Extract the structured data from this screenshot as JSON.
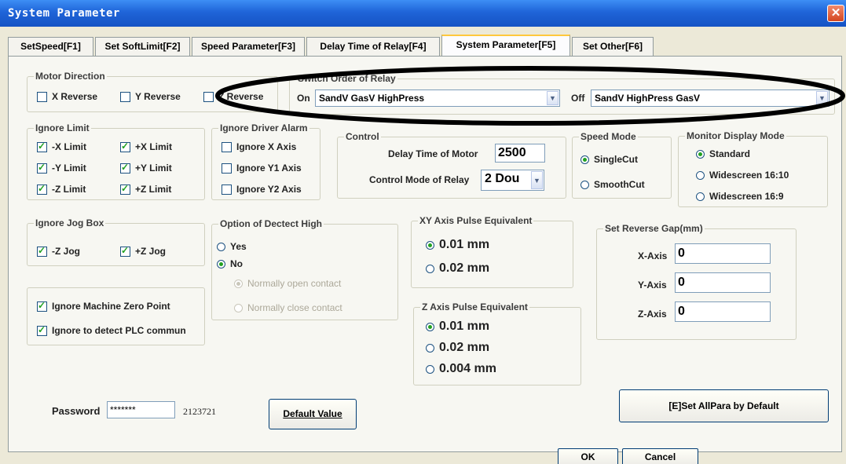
{
  "window": {
    "title": "System Parameter",
    "close_glyph": "✕"
  },
  "tabs": [
    {
      "label": "SetSpeed[F1]"
    },
    {
      "label": "Set SoftLimit[F2]"
    },
    {
      "label": "Speed Parameter[F3]"
    },
    {
      "label": "Delay Time of Relay[F4]"
    },
    {
      "label": "System Parameter[F5]",
      "active": true
    },
    {
      "label": "Set Other[F6]"
    }
  ],
  "motor_direction": {
    "title": "Motor Direction",
    "x_reverse": {
      "label": "X Reverse",
      "checked": false
    },
    "y_reverse": {
      "label": "Y Reverse",
      "checked": false
    },
    "z_reverse": {
      "label": "Z Reverse",
      "checked": false
    }
  },
  "switch_order": {
    "title": "Switch Order of Relay",
    "on_label": "On",
    "on_value": "SandV GasV HighPress",
    "off_label": "Off",
    "off_value": "SandV HighPress GasV"
  },
  "ignore_limit": {
    "title": "Ignore Limit",
    "items": [
      {
        "label": "-X Limit",
        "checked": true
      },
      {
        "label": "+X Limit",
        "checked": true
      },
      {
        "label": "-Y Limit",
        "checked": true
      },
      {
        "label": "+Y Limit",
        "checked": true
      },
      {
        "label": "-Z Limit",
        "checked": true
      },
      {
        "label": "+Z Limit",
        "checked": true
      }
    ]
  },
  "ignore_driver_alarm": {
    "title": "Ignore Driver Alarm",
    "items": [
      {
        "label": "Ignore X Axis",
        "checked": false
      },
      {
        "label": "Ignore Y1 Axis",
        "checked": false
      },
      {
        "label": "Ignore Y2 Axis",
        "checked": false
      }
    ]
  },
  "control": {
    "title": "Control",
    "delay_label": "Delay Time of Motor",
    "delay_value": "2500",
    "mode_label": "Control Mode of Relay",
    "mode_value": "2 Dou"
  },
  "speed_mode": {
    "title": "Speed Mode",
    "options": [
      {
        "label": "SingleCut",
        "selected": true
      },
      {
        "label": "SmoothCut",
        "selected": false
      }
    ]
  },
  "monitor_mode": {
    "title": "Monitor Display Mode",
    "options": [
      {
        "label": "Standard",
        "selected": true
      },
      {
        "label": "Widescreen 16:10",
        "selected": false
      },
      {
        "label": "Widescreen 16:9",
        "selected": false
      }
    ]
  },
  "ignore_jog": {
    "title": "Ignore Jog Box",
    "items": [
      {
        "label": "-Z Jog",
        "checked": true
      },
      {
        "label": "+Z Jog",
        "checked": true
      }
    ]
  },
  "option_high": {
    "title": "Option of Dectect High",
    "yes": "Yes",
    "no": "No",
    "selected": "No",
    "normally_open": "Normally open contact",
    "normally_close": "Normally close contact",
    "contact_selected": "open"
  },
  "xy_pulse": {
    "title": "XY Axis Pulse Equivalent",
    "options": [
      {
        "label": "0.01 mm",
        "selected": true
      },
      {
        "label": "0.02 mm",
        "selected": false
      }
    ]
  },
  "z_pulse": {
    "title": "Z Axis Pulse Equivalent",
    "options": [
      {
        "label": "0.01 mm",
        "selected": true
      },
      {
        "label": "0.02 mm",
        "selected": false
      },
      {
        "label": "0.004 mm",
        "selected": false
      }
    ]
  },
  "reverse_gap": {
    "title": "Set Reverse Gap(mm)",
    "x_label": "X-Axis",
    "x_value": "0",
    "y_label": "Y-Axis",
    "y_value": "0",
    "z_label": "Z-Axis",
    "z_value": "0"
  },
  "misc": {
    "ignore_zero": {
      "label": "Ignore Machine Zero Point",
      "checked": true
    },
    "ignore_plc": {
      "label": "Ignore to detect PLC commun",
      "checked": true
    }
  },
  "password": {
    "label": "Password",
    "value": "*******",
    "code": "2123721"
  },
  "buttons": {
    "default_value": "Default Value",
    "set_all": "[E]Set AllPara by Default",
    "ok": "OK",
    "cancel": "Cancel"
  },
  "colors": {
    "titlebar": "#1f64d8",
    "check": "#21a121",
    "tab_highlight": "#ffc83c",
    "annotation": "#000000"
  }
}
